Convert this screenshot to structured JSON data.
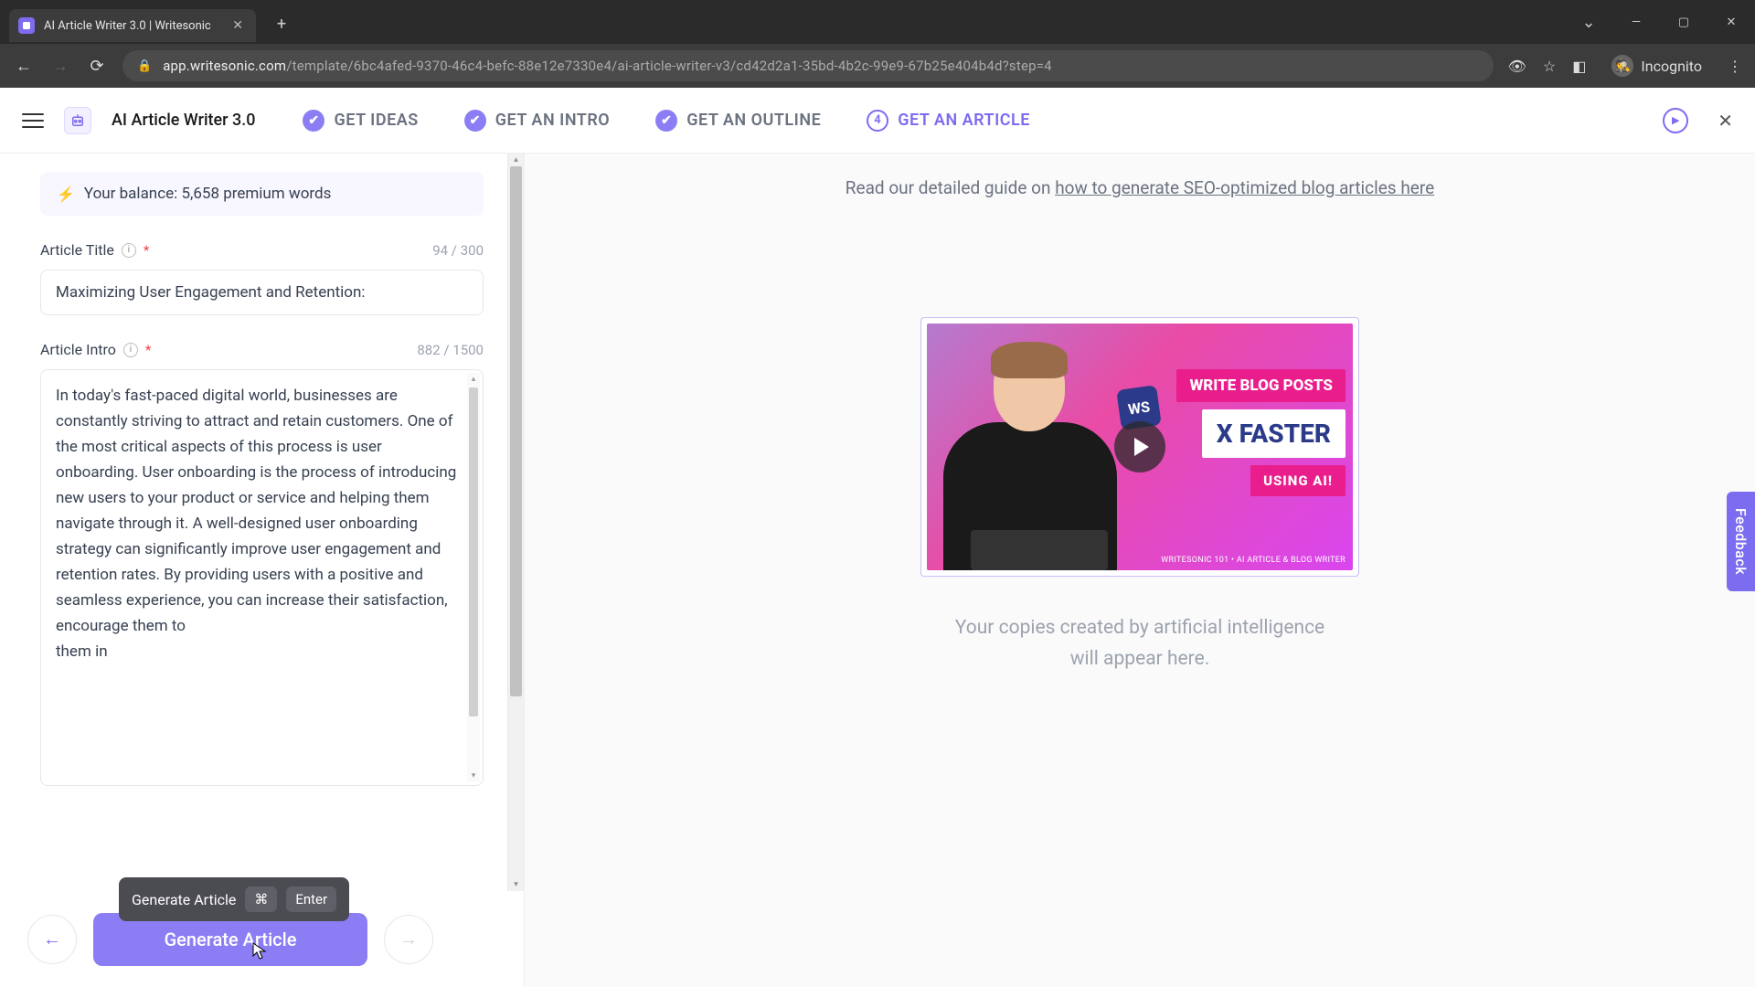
{
  "browser": {
    "tab_title": "AI Article Writer 3.0 | Writesonic",
    "url_host": "app.writesonic.com",
    "url_path": "/template/6bc4afed-9370-46c4-befc-88e12e7330e4/ai-article-writer-v3/cd42d2a1-35bd-4b2c-99e9-67b25e404b4d?step=4",
    "incognito": "Incognito"
  },
  "header": {
    "app_title": "AI Article Writer 3.0",
    "steps": [
      {
        "label": "GET IDEAS",
        "state": "done"
      },
      {
        "label": "GET AN INTRO",
        "state": "done"
      },
      {
        "label": "GET AN OUTLINE",
        "state": "done"
      },
      {
        "label": "GET AN ARTICLE",
        "state": "active",
        "num": "4"
      }
    ]
  },
  "sidebar": {
    "balance": "Your balance: 5,658 premium words",
    "title_field": {
      "label": "Article Title",
      "counter": "94 / 300",
      "value": "Maximizing User Engagement and Retention:"
    },
    "intro_field": {
      "label": "Article Intro",
      "counter": "882 / 1500",
      "value": "In today's fast-paced digital world, businesses are constantly striving to attract and retain customers. One of the most critical aspects of this process is user onboarding. User onboarding is the process of introducing new users to your product or service and helping them navigate through it. A well-designed user onboarding strategy can significantly improve user engagement and retention rates. By providing users with a positive and seamless experience, you can increase their satisfaction, encourage them to\nthem in"
    },
    "tooltip": {
      "text": "Generate Article",
      "key1": "⌘",
      "key2": "Enter"
    },
    "generate_btn": "Generate Article"
  },
  "content": {
    "guide_prefix": "Read our detailed guide on ",
    "guide_link": "how to generate SEO-optimized blog articles here",
    "video": {
      "line1": "WRITE BLOG POSTS",
      "line2": "X FASTER",
      "line3": "USING AI!",
      "footer": "WRITESONIC 101 • AI ARTICLE & BLOG WRITER",
      "ws": "WS"
    },
    "placeholder_l1": "Your copies created by artificial intelligence",
    "placeholder_l2": "will appear here."
  },
  "feedback": "Feedback"
}
